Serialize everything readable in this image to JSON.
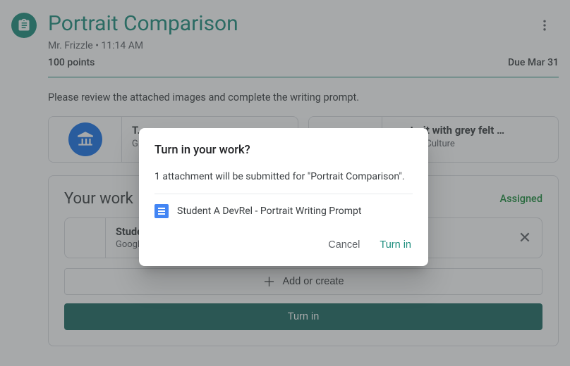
{
  "header": {
    "title": "Portrait Comparison",
    "teacher": "Mr. Frizzle",
    "time": "11:14 AM",
    "subtitle": "Mr. Frizzle • 11:14 AM",
    "points": "100 points",
    "due": "Due Mar 31"
  },
  "description": "Please review the attached images and complete the writing prompt.",
  "attachments": [
    {
      "title": "T…",
      "source": "G…"
    },
    {
      "title": "…ortrait with grey felt …",
      "source": "…Arts & Culture"
    }
  ],
  "work": {
    "heading": "Your work",
    "status": "Assigned",
    "file_title": "Studer…",
    "file_type": "Google …",
    "add_label": "Add or create",
    "turnin_label": "Turn in"
  },
  "dialog": {
    "title": "Turn in your work?",
    "body": "1 attachment will be submitted for \"Portrait Comparison\".",
    "attachment_name": "Student A DevRel - Portrait Writing Prompt",
    "cancel": "Cancel",
    "confirm": "Turn in"
  },
  "colors": {
    "accent": "#1e8e7e",
    "action_bg": "#1e6b63",
    "link_green": "#1e8e3e"
  }
}
